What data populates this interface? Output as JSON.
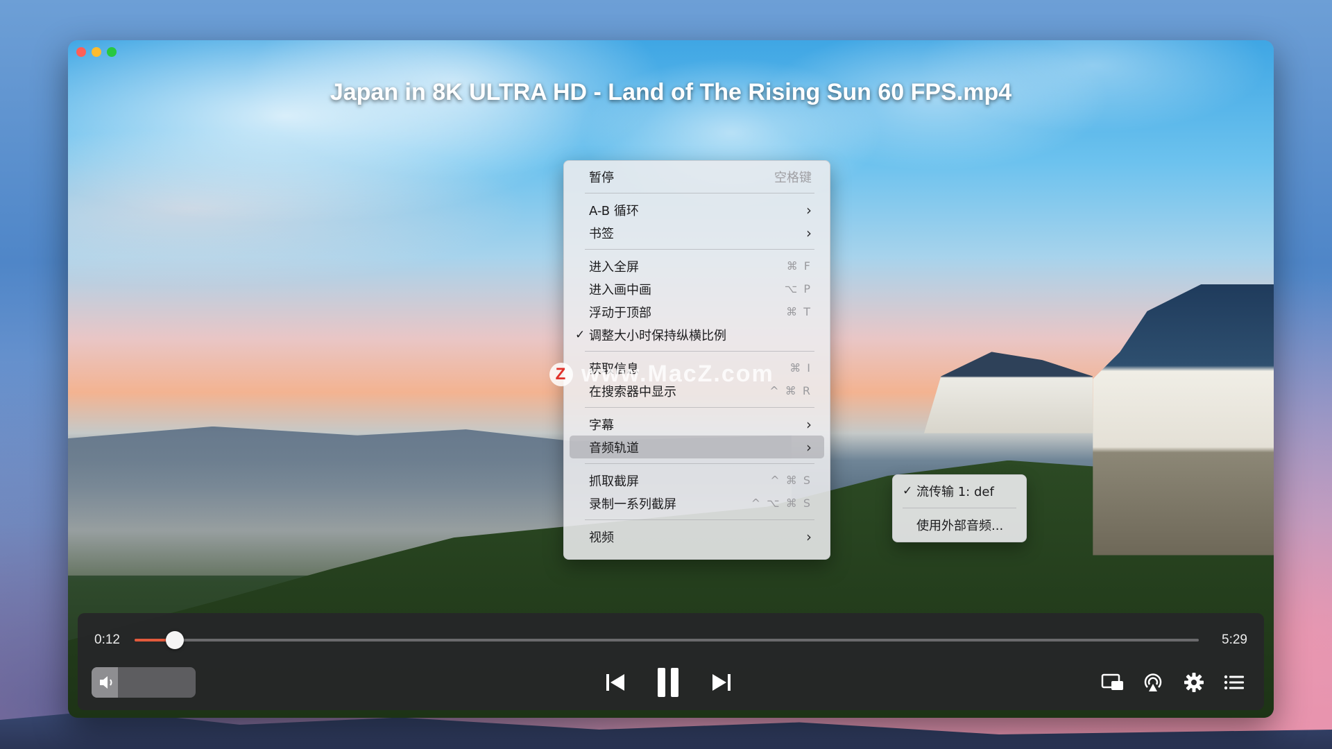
{
  "window": {
    "title": "Japan in 8K ULTRA HD - Land of The Rising Sun 60 FPS.mp4"
  },
  "menu": {
    "pause": {
      "label": "暂停",
      "shortcut": "空格键"
    },
    "ab_loop": {
      "label": "A-B 循环"
    },
    "bookmarks": {
      "label": "书签"
    },
    "fullscreen": {
      "label": "进入全屏",
      "shortcut": "⌘ F"
    },
    "pip": {
      "label": "进入画中画",
      "shortcut": "⌥ P"
    },
    "float_on_top": {
      "label": "浮动于顶部",
      "shortcut": "⌘ T"
    },
    "keep_aspect": {
      "label": "调整大小时保持纵横比例",
      "checked": true
    },
    "get_info": {
      "label": "获取信息",
      "shortcut": "⌘ I"
    },
    "show_in_finder": {
      "label": "在搜索器中显示",
      "shortcut": "^ ⌘ R"
    },
    "subtitles": {
      "label": "字幕"
    },
    "audio_track": {
      "label": "音频轨道"
    },
    "screenshot": {
      "label": "抓取截屏",
      "shortcut": "^ ⌘ S"
    },
    "screenshot_series": {
      "label": "录制一系列截屏",
      "shortcut": "^ ⌥ ⌘ S"
    },
    "video": {
      "label": "视频"
    }
  },
  "submenu_audio": {
    "stream1": {
      "label": "流传输 1: def",
      "checked": true
    },
    "external": {
      "label": "使用外部音频..."
    }
  },
  "watermark": {
    "text": "www.MacZ.com",
    "logo": "Z"
  },
  "playback": {
    "current_time": "0:12",
    "duration": "5:29",
    "progress": 0.038,
    "volume": 0.25
  },
  "colors": {
    "accent": "#e25a3c",
    "bar_bg": "#262628",
    "menu_bg": "#ececee"
  }
}
